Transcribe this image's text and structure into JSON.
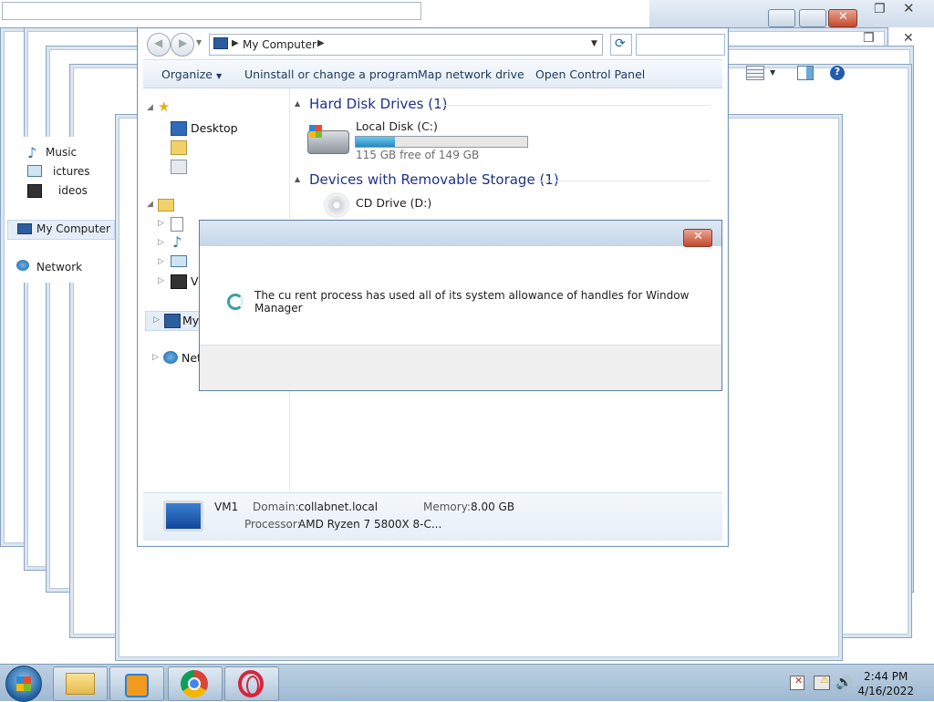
{
  "explorer": {
    "address": {
      "crumb": "My Computer"
    },
    "toolbar": {
      "organize": "Organize",
      "uninstall": "Uninstall or change a program",
      "map_drive": "Map network drive",
      "control_panel": "Open Control Panel"
    },
    "nav": {
      "desktop": "Desktop",
      "videos": "Videos",
      "my_computer": "My Computer",
      "network": "Network"
    },
    "groups": {
      "hard_disks": "Hard Disk Drives (1)",
      "removable": "Devices with Removable Storage (1)"
    },
    "local_disk": {
      "name": "Local Disk (C:)",
      "free": "115 GB free of 149 GB",
      "used_fraction": 0.23
    },
    "cd_drive": {
      "name": "CD Drive (D:)"
    },
    "details": {
      "computer": "VM1",
      "domain_label": "Domain:",
      "domain_value": "collabnet.local",
      "memory_label": "Memory:",
      "memory_value": "8.00 GB",
      "processor_label": "Processor:",
      "processor_value": "AMD Ryzen 7 5800X 8-C..."
    }
  },
  "ghost_sidebar": {
    "music": "Music",
    "pictures": "ictures",
    "videos": "ideos",
    "my_computer": "My Computer",
    "network": "Network"
  },
  "dialog": {
    "message": "The cu rent process has used all of its system allowance of handles for Window Manager"
  },
  "taskbar": {
    "time": "2:44 PM",
    "date": "4/16/2022"
  },
  "colors": {
    "accent": "#1e3287",
    "progress": "#37a2d3",
    "close": "#c44a2f"
  }
}
